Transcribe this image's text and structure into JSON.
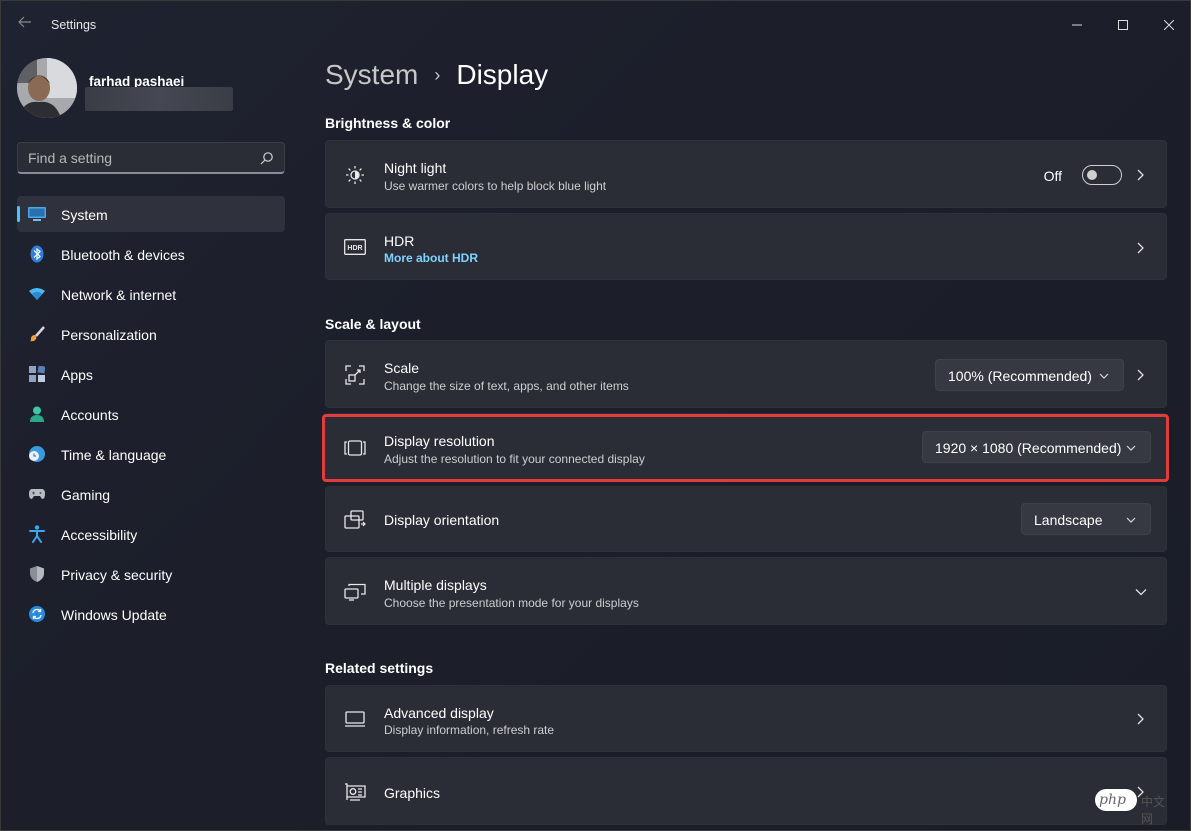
{
  "app": {
    "title": "Settings"
  },
  "user": {
    "name": "farhad pashaei"
  },
  "search": {
    "placeholder": "Find a setting"
  },
  "sidebar": {
    "items": [
      {
        "label": "System",
        "icon": "system-icon",
        "active": true
      },
      {
        "label": "Bluetooth & devices",
        "icon": "bluetooth-icon"
      },
      {
        "label": "Network & internet",
        "icon": "wifi-icon"
      },
      {
        "label": "Personalization",
        "icon": "brush-icon"
      },
      {
        "label": "Apps",
        "icon": "apps-icon"
      },
      {
        "label": "Accounts",
        "icon": "person-icon"
      },
      {
        "label": "Time & language",
        "icon": "clock-globe-icon"
      },
      {
        "label": "Gaming",
        "icon": "gamepad-icon"
      },
      {
        "label": "Accessibility",
        "icon": "accessibility-icon"
      },
      {
        "label": "Privacy & security",
        "icon": "shield-icon"
      },
      {
        "label": "Windows Update",
        "icon": "update-icon"
      }
    ]
  },
  "breadcrumb": {
    "parent": "System",
    "separator": "›",
    "current": "Display"
  },
  "sections": {
    "brightness": "Brightness & color",
    "scale_layout": "Scale & layout",
    "related": "Related settings"
  },
  "night_light": {
    "title": "Night light",
    "subtitle": "Use warmer colors to help block blue light",
    "state_label": "Off",
    "on": false
  },
  "hdr": {
    "title": "HDR",
    "link": "More about HDR"
  },
  "scale": {
    "title": "Scale",
    "subtitle": "Change the size of text, apps, and other items",
    "value": "100% (Recommended)"
  },
  "resolution": {
    "title": "Display resolution",
    "subtitle": "Adjust the resolution to fit your connected display",
    "value": "1920 × 1080 (Recommended)"
  },
  "orientation": {
    "title": "Display orientation",
    "value": "Landscape"
  },
  "multiple": {
    "title": "Multiple displays",
    "subtitle": "Choose the presentation mode for your displays"
  },
  "advanced": {
    "title": "Advanced display",
    "subtitle": "Display information, refresh rate"
  },
  "graphics": {
    "title": "Graphics"
  },
  "watermark": {
    "brand": "php",
    "suffix": "中文网"
  },
  "colors": {
    "accent": "#4cc2ff",
    "highlight": "#e13b3b",
    "card": "#2a2c36",
    "link": "#7fd3ff"
  }
}
